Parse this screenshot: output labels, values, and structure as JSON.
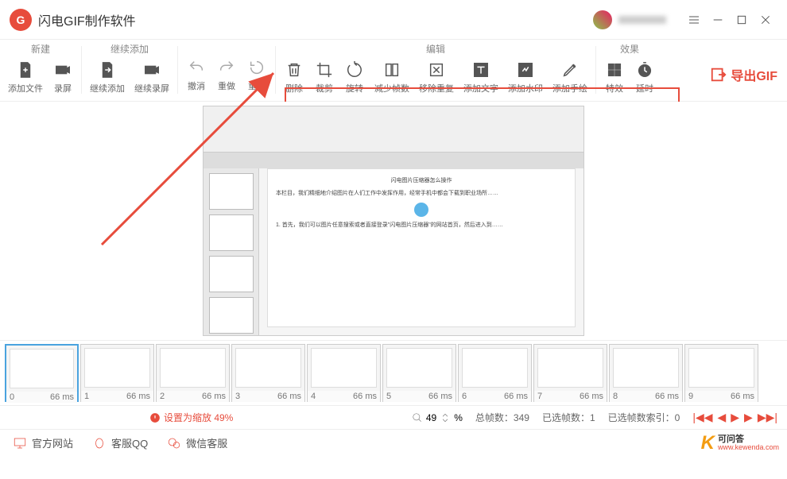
{
  "app": {
    "title": "闪电GIF制作软件"
  },
  "toolbar": {
    "groups": {
      "new": {
        "label": "新建",
        "add_file": "添加文件",
        "record": "录屏"
      },
      "append": {
        "label": "继续添加",
        "cont_add": "继续添加",
        "cont_rec": "继续录屏"
      },
      "history": {
        "undo": "撤消",
        "redo": "重做",
        "reset": "重置"
      },
      "edit": {
        "label": "编辑",
        "delete": "删除",
        "crop": "裁剪",
        "rotate": "旋转",
        "reduce": "减少帧数",
        "dedup": "移除重复",
        "text": "添加文字",
        "watermark": "添加水印",
        "hand": "添加手绘"
      },
      "effect": {
        "label": "效果",
        "fx": "特效",
        "delay": "延时"
      }
    },
    "export": "导出GIF"
  },
  "frames": {
    "count": 10,
    "sel": 0,
    "duration": "66 ms"
  },
  "status": {
    "warn": "设置为缩放 49%",
    "zoom_val": "49",
    "zoom_unit": "%",
    "total": "总帧数：349",
    "selected": "已选帧数：1",
    "index": "已选帧数索引：0"
  },
  "footer": {
    "site": "官方网站",
    "qq": "客服QQ",
    "wechat": "微信客服"
  },
  "watermark": {
    "cn": "可问答",
    "en": "www.kewenda.com"
  }
}
